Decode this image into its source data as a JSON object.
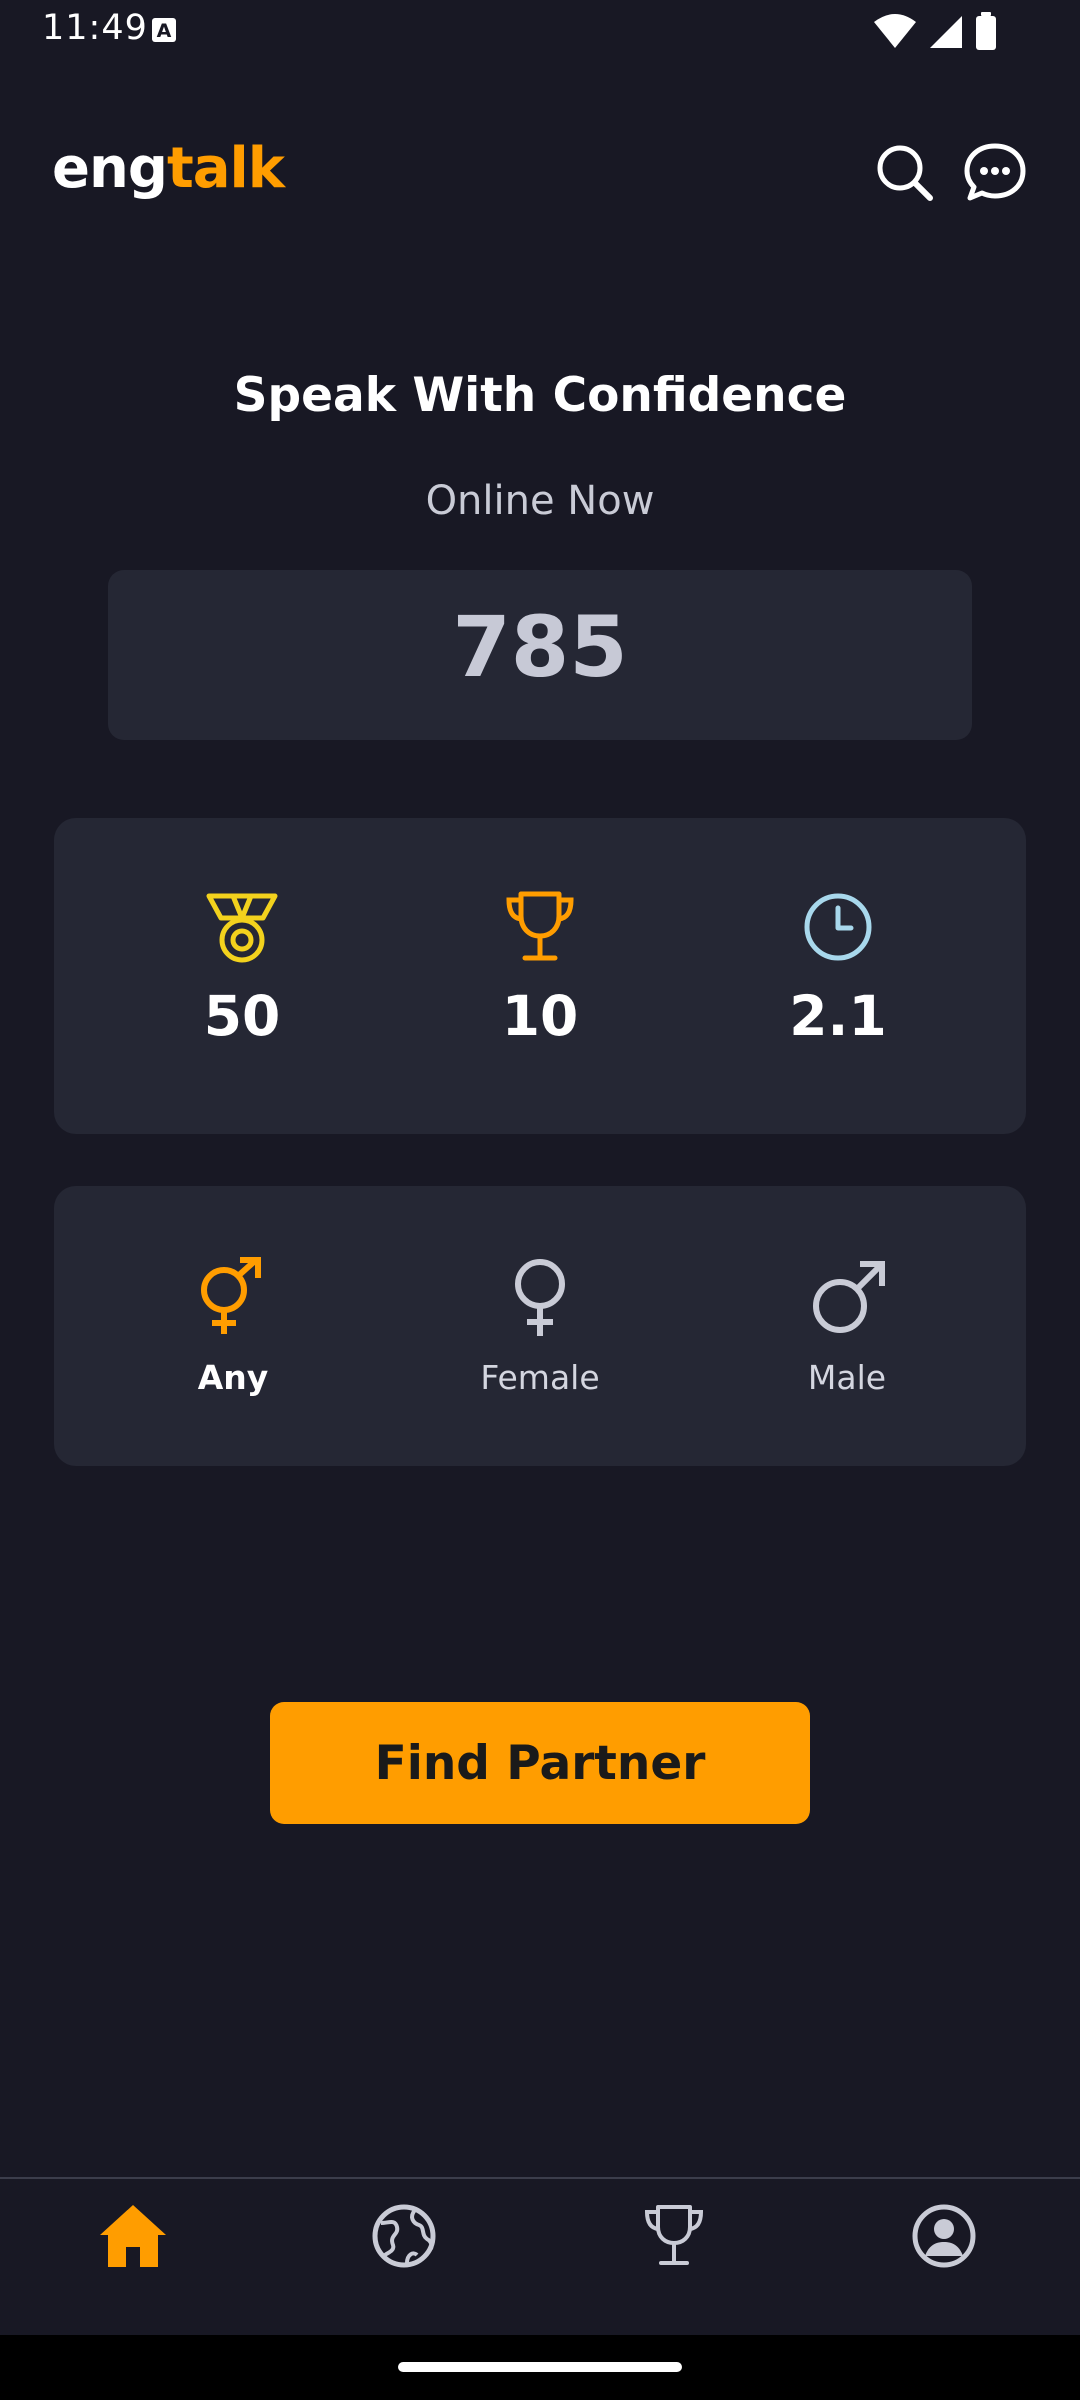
{
  "status_bar": {
    "time": "11:49",
    "indicator_letter": "A"
  },
  "header": {
    "logo_part1": "eng",
    "logo_part2": "talk",
    "icons": [
      "search-icon",
      "chat-icon"
    ]
  },
  "hero": {
    "title": "Speak With Confidence",
    "online_label": "Online Now",
    "online_count": "785"
  },
  "stats": [
    {
      "icon": "medal-icon",
      "value": "50",
      "color": "#F3D21D"
    },
    {
      "icon": "trophy-icon",
      "value": "10",
      "color": "#FF9D00"
    },
    {
      "icon": "clock-icon",
      "value": "2.1",
      "color": "#A8D8EC"
    }
  ],
  "gender_filter": {
    "selected": "Any",
    "options": [
      {
        "icon": "gender-any-icon",
        "label": "Any"
      },
      {
        "icon": "female-icon",
        "label": "Female"
      },
      {
        "icon": "male-icon",
        "label": "Male"
      }
    ]
  },
  "primary_action": {
    "label": "Find Partner"
  },
  "bottom_nav": {
    "active": "home",
    "items": [
      "home-icon",
      "globe-icon",
      "trophy-icon",
      "profile-icon"
    ]
  },
  "colors": {
    "background": "#181824",
    "card": "#252734",
    "accent": "#FF9D00",
    "text_muted": "#c9cbd6"
  }
}
